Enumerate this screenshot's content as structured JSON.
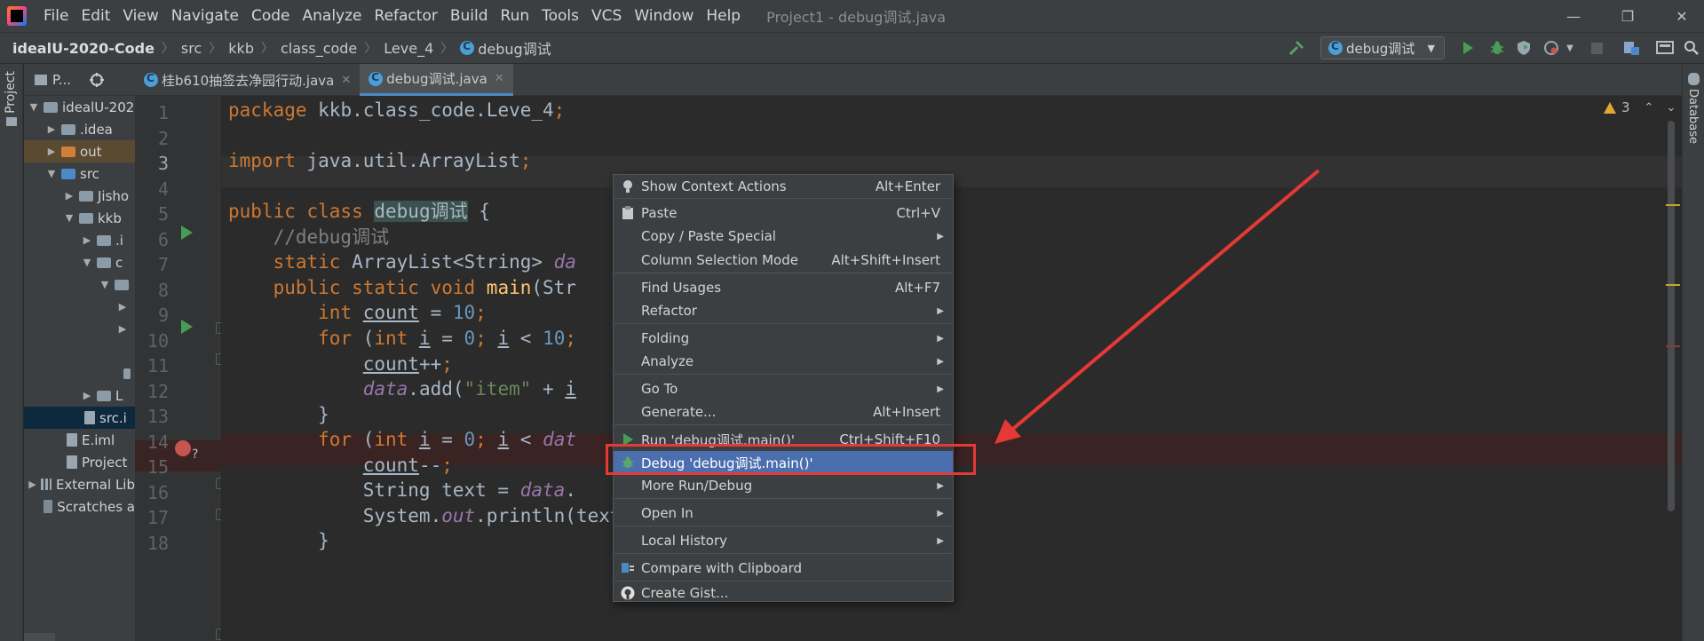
{
  "menubar": {
    "items": [
      "File",
      "Edit",
      "View",
      "Navigate",
      "Code",
      "Analyze",
      "Refactor",
      "Build",
      "Run",
      "Tools",
      "VCS",
      "Window",
      "Help"
    ],
    "title": "Project1 - debug调试.java",
    "minimize": "—",
    "restore": "❐",
    "close": "✕"
  },
  "breadcrumb": {
    "root": "idealU-2020-Code",
    "parts": [
      "src",
      "kkb",
      "class_code",
      "Leve_4",
      "debug调试"
    ]
  },
  "toolbar": {
    "run_config": "debug调试",
    "dropdown_arrow": "▼"
  },
  "left_strip": {
    "label": "Project"
  },
  "right_strip": {
    "label": "Database"
  },
  "project": {
    "header": "P...",
    "tree": [
      {
        "label": "idealU-202",
        "arrow": "▼"
      },
      {
        "label": ".idea",
        "arrow": "▶"
      },
      {
        "label": "out",
        "arrow": "▶"
      },
      {
        "label": "src",
        "arrow": "▼"
      },
      {
        "label": "Jisho",
        "arrow": "▶"
      },
      {
        "label": "kkb",
        "arrow": "▼"
      },
      {
        "label": ".i",
        "arrow": "▶"
      },
      {
        "label": "c",
        "arrow": "▼"
      },
      {
        "label": "",
        "arrow": "▼"
      },
      {
        "label": "",
        "arrow": "▶"
      },
      {
        "label": "",
        "arrow": "▶"
      },
      {
        "label": "",
        "arrow": ""
      },
      {
        "label": "",
        "arrow": ""
      },
      {
        "label": "L",
        "arrow": "▶"
      },
      {
        "label": "src.i",
        "arrow": ""
      },
      {
        "label": "E.iml",
        "arrow": ""
      },
      {
        "label": "Project",
        "arrow": ""
      },
      {
        "label": "External Lib",
        "arrow": "▶"
      },
      {
        "label": "Scratches a",
        "arrow": ""
      }
    ]
  },
  "tabs": [
    {
      "label": "桂b610抽签去净园行动.java",
      "close": "✕"
    },
    {
      "label": "debug调试.java",
      "close": "✕"
    }
  ],
  "editor": {
    "warnings": "3",
    "line_numbers": [
      "1",
      "2",
      "3",
      "4",
      "5",
      "6",
      "7",
      "8",
      "9",
      "10",
      "11",
      "12",
      "13",
      "14",
      "15",
      "16",
      "17",
      "18"
    ],
    "lines": {
      "l1a": "package ",
      "l1b": "kkb.class_code.Leve_4",
      "l1c": ";",
      "l3a": "import ",
      "l3b": "java.util.ArrayList",
      "l3c": ";",
      "l5a": "public class ",
      "l5b": "debug调试",
      "l5c": " {",
      "l6": "    //debug调试",
      "l7a": "    static ",
      "l7b": "ArrayList<String> ",
      "l7c": "da",
      "l8a": "    public static void ",
      "l8b": "main",
      "l8c": "(Str",
      "l9a": "        int ",
      "l9b": "count",
      "l9c": " = ",
      "l9d": "10",
      "l9e": ";",
      "l10a": "        for ",
      "l10b": "(",
      "l10c": "int ",
      "l10d": "i",
      "l10e": " = ",
      "l10f": "0",
      "l10g": "; ",
      "l10h": "i",
      "l10i": " < ",
      "l10j": "10",
      "l10k": ";",
      "l11a": "            ",
      "l11b": "count",
      "l11c": "++",
      "l11d": ";",
      "l12a": "            ",
      "l12b": "data",
      "l12c": ".add(",
      "l12d": "\"item\"",
      "l12e": " + ",
      "l12f": "i",
      "l13": "        }",
      "l14a": "        for ",
      "l14b": "(",
      "l14c": "int ",
      "l14d": "i",
      "l14e": " = ",
      "l14f": "0",
      "l14g": "; ",
      "l14h": "i",
      "l14i": " < ",
      "l14j": "dat",
      "l15a": "            ",
      "l15b": "count",
      "l15c": "--",
      "l15d": ";",
      "l16a": "            String text = ",
      "l16b": "data",
      "l16c": ".",
      "l17a": "            System.",
      "l17b": "out",
      "l17c": ".println(text)",
      "l17d": ";",
      "l18": "        }"
    },
    "breakpoint_hint": "?"
  },
  "context_menu": {
    "items": [
      {
        "label": "Show Context Actions",
        "shortcut": "Alt+Enter"
      },
      {
        "label": "Paste",
        "shortcut": "Ctrl+V"
      },
      {
        "label": "Copy / Paste Special",
        "shortcut": "▶"
      },
      {
        "label": "Column Selection Mode",
        "shortcut": "Alt+Shift+Insert"
      },
      {
        "label": "Find Usages",
        "shortcut": "Alt+F7"
      },
      {
        "label": "Refactor",
        "shortcut": "▶"
      },
      {
        "label": "Folding",
        "shortcut": "▶"
      },
      {
        "label": "Analyze",
        "shortcut": "▶"
      },
      {
        "label": "Go To",
        "shortcut": "▶"
      },
      {
        "label": "Generate...",
        "shortcut": "Alt+Insert"
      },
      {
        "label": "Run 'debug调试.main()'",
        "shortcut": "Ctrl+Shift+F10"
      },
      {
        "label": "Debug 'debug调试.main()'",
        "shortcut": ""
      },
      {
        "label": "More Run/Debug",
        "shortcut": "▶"
      },
      {
        "label": "Open In",
        "shortcut": "▶"
      },
      {
        "label": "Local History",
        "shortcut": "▶"
      },
      {
        "label": "Compare with Clipboard",
        "shortcut": ""
      },
      {
        "label": "Create Gist...",
        "shortcut": ""
      }
    ]
  },
  "colors": {
    "selection": "#4b6eaf",
    "annotation": "#e53935",
    "keyword": "#cc7832",
    "string": "#6a8759",
    "number": "#6897bb"
  }
}
